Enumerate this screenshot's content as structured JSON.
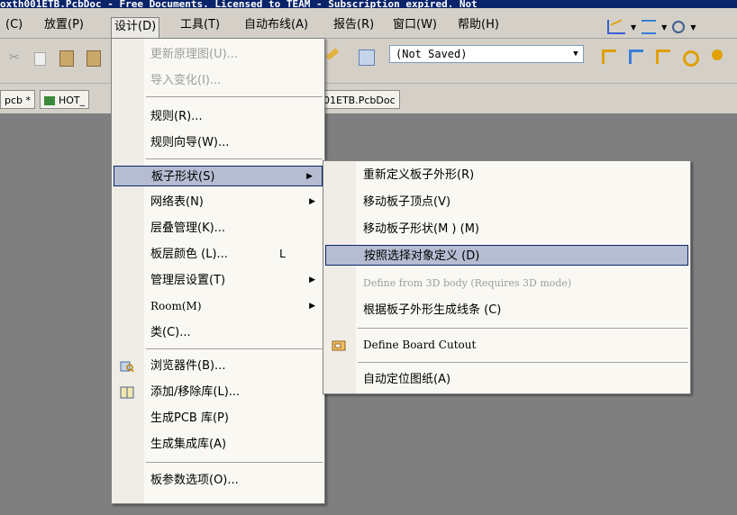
{
  "window": {
    "title_fragment": "oxth001ETB.PcbDoc - Free Documents. Licensed to TEAM - Subscription expired. Not"
  },
  "menubar": {
    "items": [
      {
        "label": "(C)"
      },
      {
        "label": "放置(P)"
      },
      {
        "label": "设计(D)"
      },
      {
        "label": "工具(T)"
      },
      {
        "label": "自动布线(A)"
      },
      {
        "label": "报告(R)"
      },
      {
        "label": "窗口(W)"
      },
      {
        "label": "帮助(H)"
      }
    ]
  },
  "toolbar": {
    "variant_combo": "(Not Saved)"
  },
  "tabs": [
    {
      "label": "pcb *"
    },
    {
      "label": "HOT_"
    },
    {
      "label": "01ETB.PcbDoc"
    }
  ],
  "design_menu": {
    "items": [
      {
        "label": "更新原理图(U)...",
        "disabled": true
      },
      {
        "label": "导入变化(I)...",
        "disabled": true
      },
      {
        "label": "规则(R)..."
      },
      {
        "label": "规则向导(W)..."
      },
      {
        "label": "板子形状(S)",
        "submenu": true,
        "highlighted": true
      },
      {
        "label": "网络表(N)",
        "submenu": true
      },
      {
        "label": "层叠管理(K)..."
      },
      {
        "label": "板层颜色 (L)...",
        "shortcut": "L"
      },
      {
        "label": "管理层设置(T)",
        "submenu": true
      },
      {
        "label": "Room(M)",
        "submenu": true
      },
      {
        "label": "类(C)..."
      },
      {
        "label": "浏览器件(B)...",
        "icon": "component-browser-icon"
      },
      {
        "label": "添加/移除库(L)...",
        "icon": "library-book-icon"
      },
      {
        "label": "生成PCB 库(P)"
      },
      {
        "label": "生成集成库(A)"
      },
      {
        "label": "板参数选项(O)..."
      }
    ]
  },
  "board_shape_submenu": {
    "items": [
      {
        "label": "重新定义板子外形(R)"
      },
      {
        "label": "移动板子顶点(V)"
      },
      {
        "label": "移动板子形状(M ) (M)"
      },
      {
        "label": "按照选择对象定义 (D)",
        "highlighted": true
      },
      {
        "label": "Define from 3D body (Requires 3D mode)",
        "disabled": true
      },
      {
        "label": "根据板子外形生成线条 (C)"
      },
      {
        "label": "Define Board Cutout",
        "icon": "board-cutout-icon"
      },
      {
        "label": "自动定位图纸(A)"
      }
    ]
  },
  "colors": {
    "menu_bg": "#f9f8f3",
    "highlight": "#b6bdd2",
    "highlight_border": "#0a246a",
    "workspace": "#7f7f7f",
    "chrome": "#d4d0c8"
  }
}
